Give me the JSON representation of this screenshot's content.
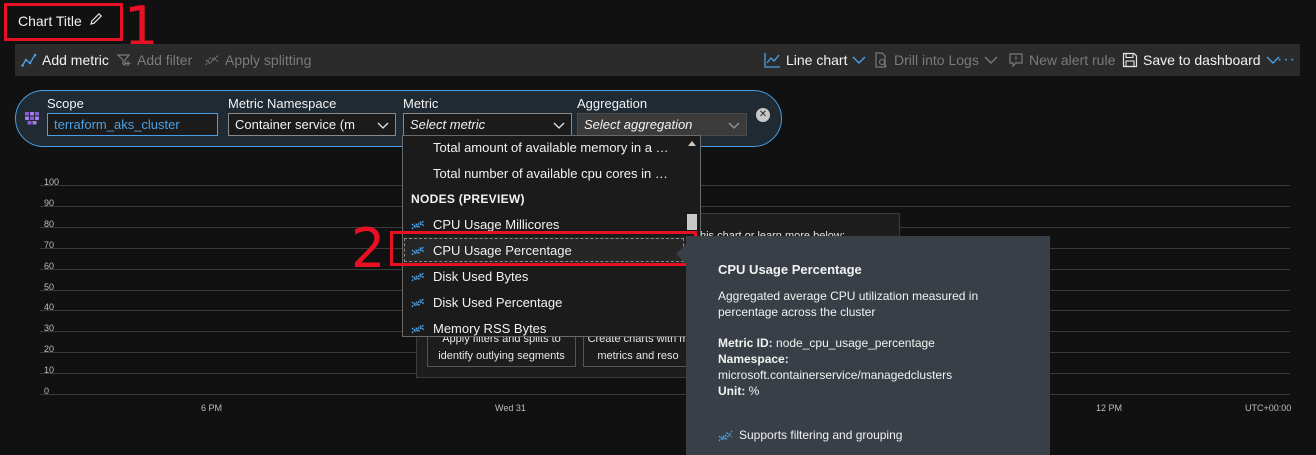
{
  "chart_title": "Chart Title",
  "annotations": {
    "step1": "1",
    "step2": "2"
  },
  "toolbar": {
    "add_metric": "Add metric",
    "add_filter": "Add filter",
    "apply_splitting": "Apply splitting",
    "line_chart": "Line chart",
    "drill_into_logs": "Drill into Logs",
    "new_alert_rule": "New alert rule",
    "save_to_dashboard": "Save to dashboard",
    "more": "···"
  },
  "metric_selector": {
    "scope_label": "Scope",
    "scope_value": "terraform_aks_cluster",
    "namespace_label": "Metric Namespace",
    "namespace_value": "Container service (m",
    "metric_label": "Metric",
    "metric_placeholder": "Select metric",
    "aggregation_label": "Aggregation",
    "aggregation_placeholder": "Select aggregation"
  },
  "dropdown": {
    "items": [
      {
        "label": "Total amount of available memory in a …",
        "type": "item",
        "icon": false
      },
      {
        "label": "Total number of available cpu cores in …",
        "type": "item",
        "icon": false
      },
      {
        "label": "NODES (PREVIEW)",
        "type": "header",
        "icon": false
      },
      {
        "label": "CPU Usage Millicores",
        "type": "item",
        "icon": true
      },
      {
        "label": "CPU Usage Percentage",
        "type": "item",
        "icon": true,
        "selected": true
      },
      {
        "label": "Disk Used Bytes",
        "type": "item",
        "icon": true
      },
      {
        "label": "Disk Used Percentage",
        "type": "item",
        "icon": true
      },
      {
        "label": "Memory RSS Bytes",
        "type": "item",
        "icon": true
      }
    ]
  },
  "chart": {
    "y_ticks": [
      "100",
      "90",
      "80",
      "70",
      "60",
      "50",
      "40",
      "30",
      "20",
      "10",
      "0"
    ],
    "x_ticks": [
      "6 PM",
      "Wed 31",
      "12 PM"
    ],
    "timezone": "UTC+00:00"
  },
  "background_card": {
    "text": "his chart or learn more below:",
    "card1": "Apply filters and splits to identify outlying segments",
    "card2": "Create charts with m metrics and reso"
  },
  "tooltip": {
    "title": "CPU Usage Percentage",
    "description": "Aggregated average CPU utilization measured in percentage across the cluster",
    "metric_id_label": "Metric ID:",
    "metric_id": "node_cpu_usage_percentage",
    "namespace_label": "Namespace:",
    "namespace": "microsoft.containerservice/managedclusters",
    "unit_label": "Unit:",
    "unit": "%",
    "footer": "Supports filtering and grouping"
  }
}
